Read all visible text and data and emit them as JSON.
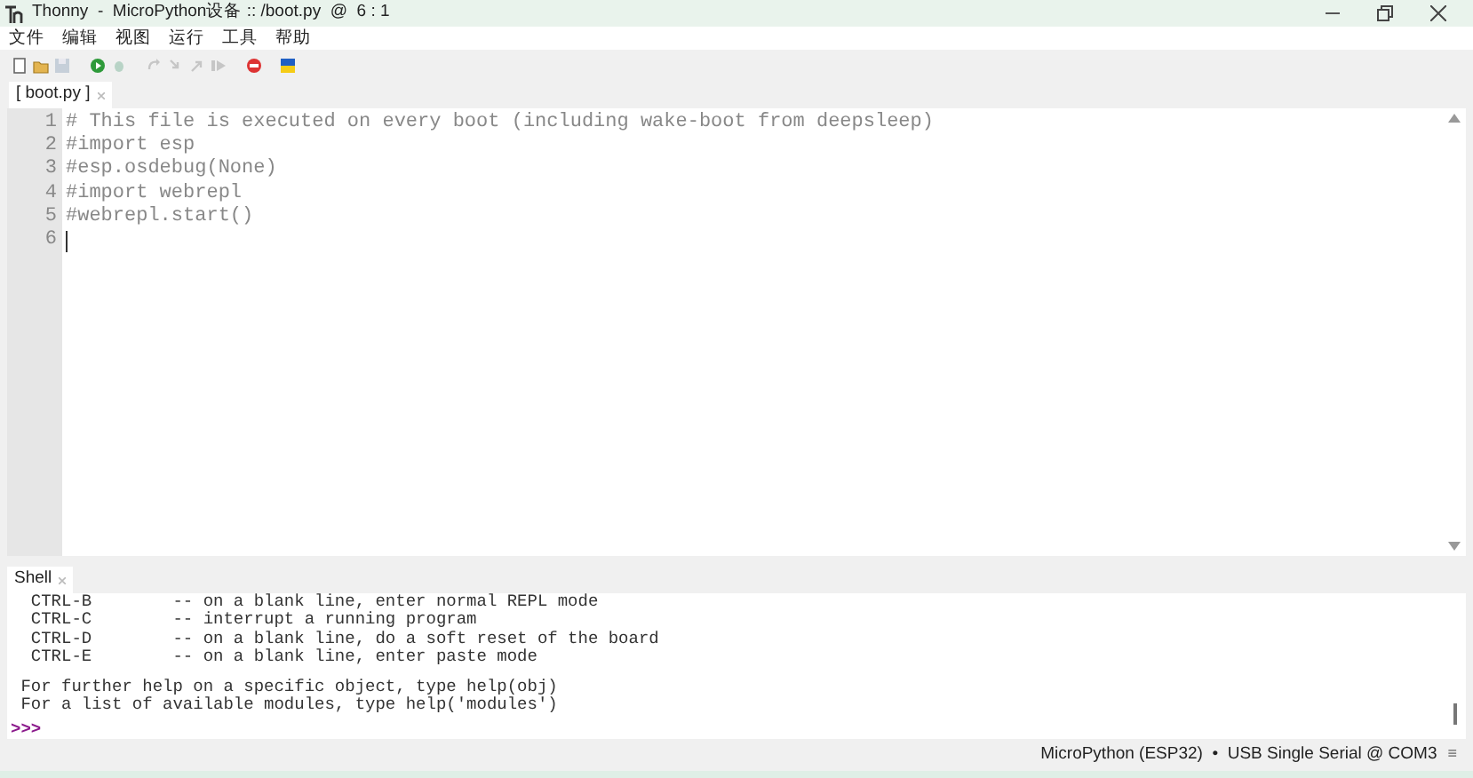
{
  "window": {
    "title": "Thonny  -  MicroPython设备 :: /boot.py  @  6 : 1"
  },
  "menu": [
    "文件",
    "编辑",
    "视图",
    "运行",
    "工具",
    "帮助"
  ],
  "toolbar": [
    {
      "kind": "new",
      "disabled": false
    },
    {
      "kind": "open",
      "disabled": false
    },
    {
      "kind": "save",
      "disabled": true
    },
    {
      "kind": "run",
      "disabled": false
    },
    {
      "kind": "debug",
      "disabled": true
    },
    {
      "kind": "step-over",
      "disabled": true
    },
    {
      "kind": "step-into",
      "disabled": true
    },
    {
      "kind": "step-out",
      "disabled": true
    },
    {
      "kind": "resume",
      "disabled": true
    },
    {
      "kind": "stop",
      "disabled": false
    },
    {
      "kind": "flag",
      "disabled": false
    }
  ],
  "editor_tabs": [
    {
      "label": "[ boot.py ]",
      "selected": true
    }
  ],
  "editor": {
    "lines": [
      {
        "number": "1",
        "text": "# This file is executed on every boot (including wake-boot from deepsleep)"
      },
      {
        "number": "2",
        "text": "#import esp"
      },
      {
        "number": "3",
        "text": "#esp.osdebug(None)"
      },
      {
        "number": "4",
        "text": "#import webrepl"
      },
      {
        "number": "5",
        "text": "#webrepl.start()"
      },
      {
        "number": "6"
      }
    ]
  },
  "shell": {
    "tab": {
      "label": "Shell",
      "selected": true
    },
    "paragraphs": [
      [
        "  CTRL-B        -- on a blank line, enter normal REPL mode",
        "  CTRL-C        -- interrupt a running program",
        "  CTRL-D        -- on a blank line, do a soft reset of the board",
        "  CTRL-E        -- on a blank line, enter paste mode"
      ],
      [
        " For further help on a specific object, type help(obj)",
        " For a list of available modules, type help('modules')"
      ]
    ],
    "prompt": ">>>"
  },
  "status_bar": {
    "text": "MicroPython (ESP32)  •  USB Single Serial @ COM3",
    "menu_glyph": "≡"
  }
}
